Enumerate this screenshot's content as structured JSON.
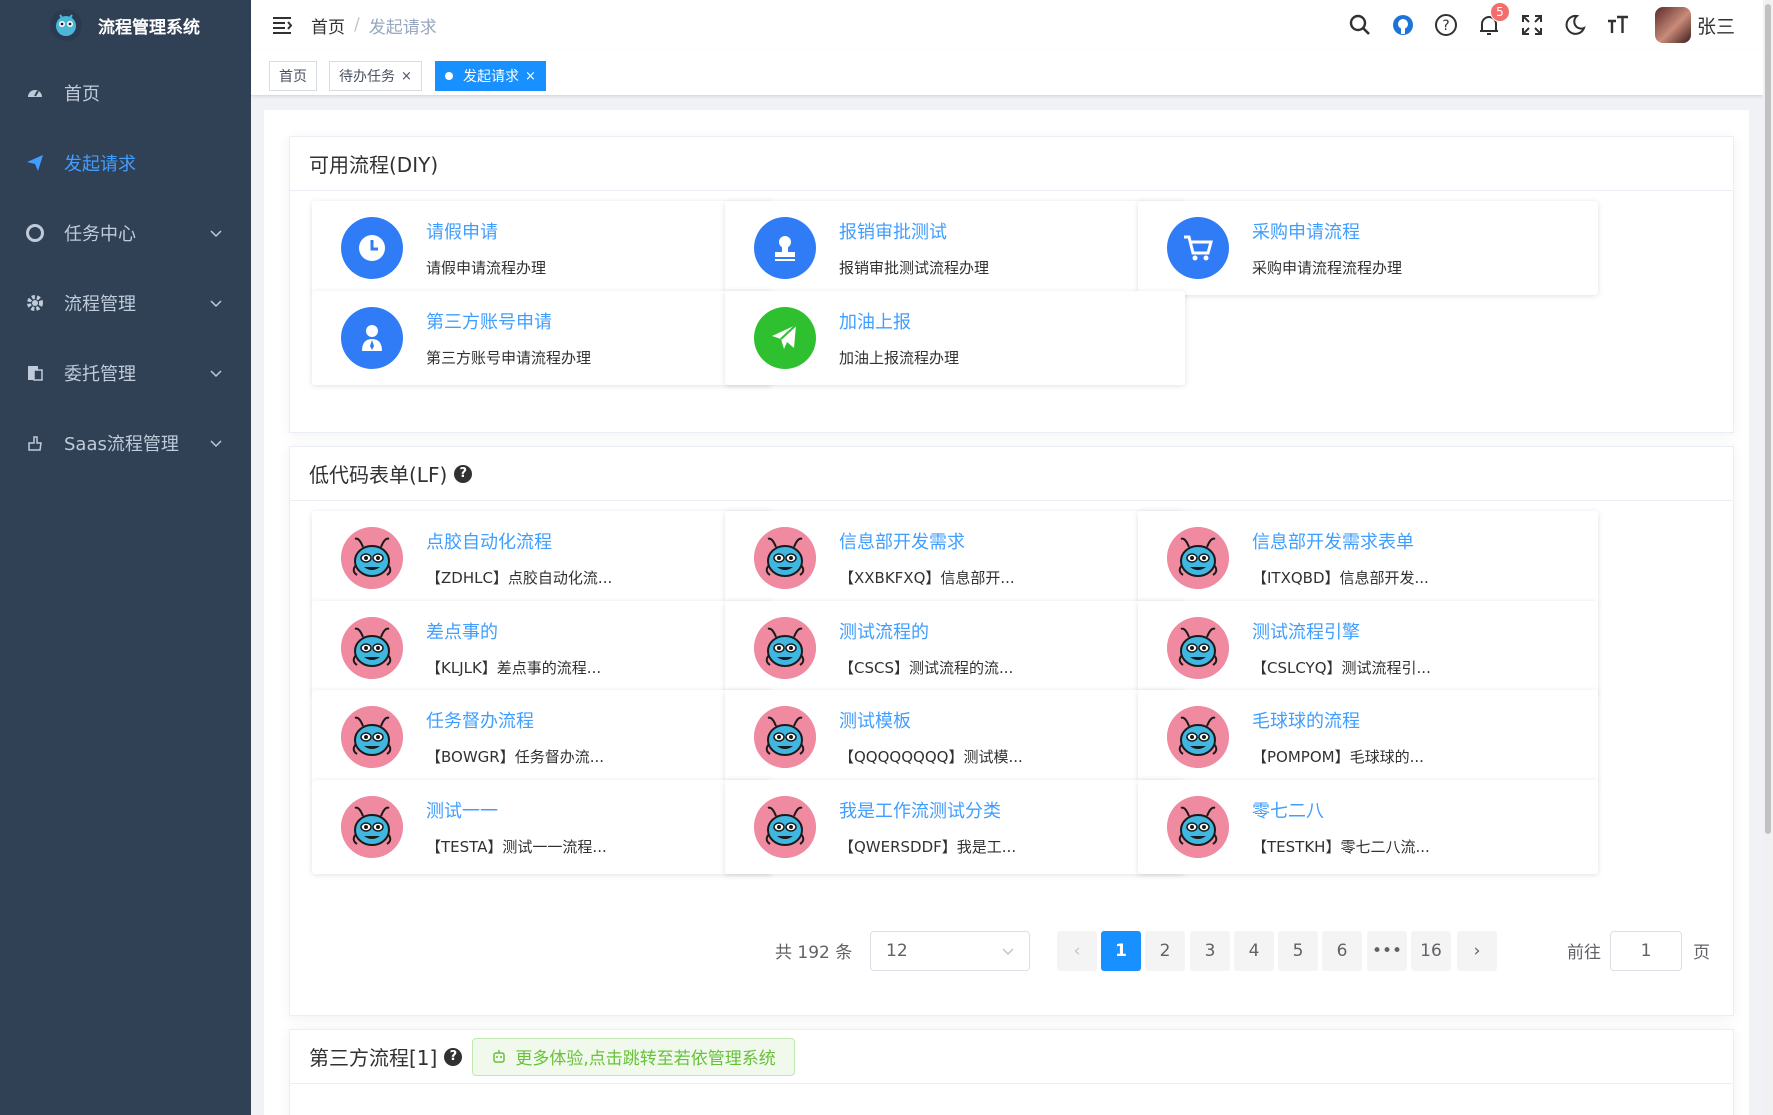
{
  "app": {
    "title": "流程管理系统"
  },
  "sidebar": {
    "items": [
      {
        "label": "首页",
        "icon": "dashboard-icon"
      },
      {
        "label": "发起请求",
        "icon": "send-icon",
        "active": true
      },
      {
        "label": "任务中心",
        "icon": "lifebuoy-icon",
        "expandable": true
      },
      {
        "label": "流程管理",
        "icon": "gear-icon",
        "expandable": true
      },
      {
        "label": "委托管理",
        "icon": "document-icon",
        "expandable": true
      },
      {
        "label": "Saas流程管理",
        "icon": "hand-icon",
        "expandable": true
      }
    ]
  },
  "header": {
    "breadcrumb": {
      "home": "首页",
      "separator": "/",
      "current": "发起请求"
    },
    "notification_count": "5",
    "username": "张三"
  },
  "tags": {
    "home": "首页",
    "todo": "待办任务",
    "current": "发起请求",
    "close": "×"
  },
  "diy": {
    "title": "可用流程(DIY)",
    "items": [
      {
        "title": "请假申请",
        "desc": "请假申请流程办理",
        "icon": "clock-icon",
        "color": "#2f7cf6"
      },
      {
        "title": "报销审批测试",
        "desc": "报销审批测试流程办理",
        "icon": "stamp-icon",
        "color": "#2f7cf6"
      },
      {
        "title": "采购申请流程",
        "desc": "采购申请流程流程办理",
        "icon": "cart-icon",
        "color": "#2f7cf6"
      },
      {
        "title": "第三方账号申请",
        "desc": "第三方账号申请流程办理",
        "icon": "user-tie-icon",
        "color": "#2f7cf6"
      },
      {
        "title": "加油上报",
        "desc": "加油上报流程办理",
        "icon": "plane-icon",
        "color": "#2fc02f"
      }
    ]
  },
  "lf": {
    "title": "低代码表单(LF)",
    "help": "?",
    "items": [
      {
        "title": "点胶自动化流程",
        "desc": "【ZDHLC】点胶自动化流..."
      },
      {
        "title": "信息部开发需求",
        "desc": "【XXBKFXQ】信息部开..."
      },
      {
        "title": "信息部开发需求表单",
        "desc": "【ITXQBD】信息部开发..."
      },
      {
        "title": "差点事的",
        "desc": "【KLJLK】差点事的流程..."
      },
      {
        "title": "测试流程的",
        "desc": "【CSCS】测试流程的流..."
      },
      {
        "title": "测试流程引擎",
        "desc": "【CSLCYQ】测试流程引..."
      },
      {
        "title": "任务督办流程",
        "desc": "【BOWGR】任务督办流..."
      },
      {
        "title": "测试模板",
        "desc": "【QQQQQQQQ】测试模..."
      },
      {
        "title": "毛球球的流程",
        "desc": "【POMPOM】毛球球的..."
      },
      {
        "title": "测试一一",
        "desc": "【TESTA】测试一一流程..."
      },
      {
        "title": "我是工作流测试分类",
        "desc": "【QWERSDDF】我是工..."
      },
      {
        "title": "零七二八",
        "desc": "【TESTKH】零七二八流..."
      }
    ],
    "pagination": {
      "total": "共 192 条",
      "page_size": "12",
      "pages": [
        "1",
        "2",
        "3",
        "4",
        "5",
        "6",
        "•••",
        "16"
      ],
      "current": "1",
      "prev": "‹",
      "next": "›",
      "goto_label": "前往",
      "goto_value": "1",
      "page_suffix": "页"
    }
  },
  "third": {
    "title": "第三方流程[1]",
    "help": "?",
    "notice": "更多体验,点击跳转至若依管理系统"
  },
  "colors": {
    "accent": "#1890ff",
    "sidebar_bg": "#304156",
    "link": "#409eff"
  }
}
